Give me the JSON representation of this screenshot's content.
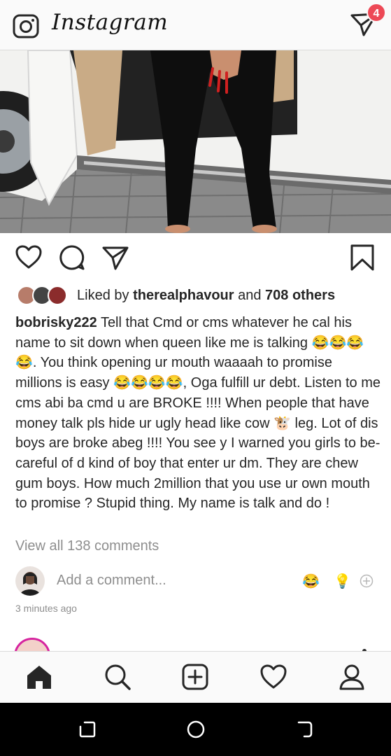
{
  "topbar": {
    "logo_text": "Instagram",
    "dm_badge_count": "4",
    "badge_color": "#ed4956"
  },
  "post": {
    "likes": {
      "prefix": "Liked by ",
      "user": "therealphavour",
      "middle": " and ",
      "others": "708 others"
    },
    "caption": {
      "username": "bobrisky222",
      "text": "Tell that Cmd or cms whatever he cal his name to sit down when queen like me is talking 😂😂😂😂. You think opening ur mouth waaaah to promise millions is easy 😂😂😂😂, Oga fulfill ur debt. Listen to me cms abi ba cmd u are BROKE !!!! When people that have money talk pls hide ur ugly head like cow 🐮 leg. Lot of dis boys are broke abeg !!!! You see y I warned you girls to be-careful of d kind of boy that enter ur dm. They are chew gum boys. How much 2million that you use ur own mouth to promise ? Stupid thing. My name is talk and do !"
    },
    "view_all_comments": "View all 138 comments",
    "comment_placeholder": "Add a comment...",
    "quick_emojis": [
      "😂",
      "💡"
    ],
    "time_ago": "3 minutes ago"
  },
  "icons": {
    "topbar": [
      "camera-icon",
      "direct-message-icon"
    ],
    "actions": [
      "heart-icon",
      "comment-icon",
      "share-icon",
      "bookmark-icon"
    ],
    "tabbar": [
      "home-icon",
      "search-icon",
      "add-post-icon",
      "activity-heart-icon",
      "profile-icon"
    ],
    "system_nav": [
      "recents-icon",
      "home-circle-icon",
      "back-icon"
    ]
  }
}
